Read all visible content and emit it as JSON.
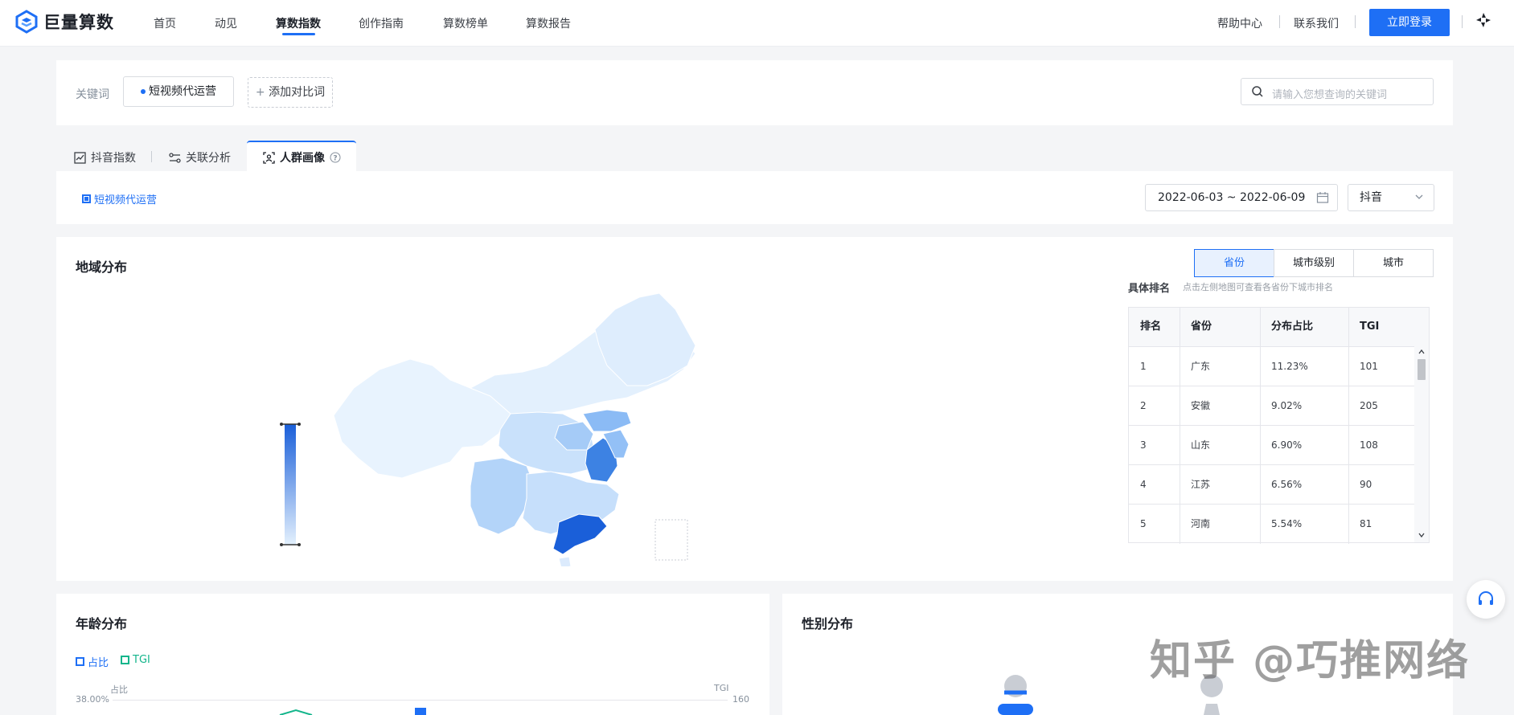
{
  "nav": {
    "logo": "巨量算数",
    "items": [
      "首页",
      "动见",
      "算数指数",
      "创作指南",
      "算数榜单",
      "算数报告"
    ],
    "right": [
      "帮助中心",
      "联系我们"
    ],
    "login": "立即登录"
  },
  "keywords": {
    "label": "关键词",
    "chip": "短视频代运营",
    "add": "添加对比词",
    "search_placeholder": "请输入您想查询的关键词"
  },
  "tabs": [
    "抖音指数",
    "关联分析",
    "人群画像"
  ],
  "filter": {
    "legend": "短视频代运营",
    "date_range": "2022-06-03 ~ 2022-06-09",
    "platform": "抖音"
  },
  "region": {
    "title": "地域分布",
    "segments": [
      "省份",
      "城市级别",
      "城市"
    ],
    "rank_title": "具体排名",
    "rank_subtitle": "点击左侧地图可查看各省份下城市排名",
    "headers": [
      "排名",
      "省份",
      "分布占比",
      "TGI"
    ],
    "rows": [
      {
        "rank": "1",
        "province": "广东",
        "share": "11.23%",
        "tgi": "101"
      },
      {
        "rank": "2",
        "province": "安徽",
        "share": "9.02%",
        "tgi": "205"
      },
      {
        "rank": "3",
        "province": "山东",
        "share": "6.90%",
        "tgi": "108"
      },
      {
        "rank": "4",
        "province": "江苏",
        "share": "6.56%",
        "tgi": "90"
      },
      {
        "rank": "5",
        "province": "河南",
        "share": "5.54%",
        "tgi": "81"
      }
    ]
  },
  "age": {
    "title": "年龄分布",
    "legend_share": "占比",
    "legend_tgi": "TGI",
    "y_left_label": "占比",
    "y_right_label": "TGI",
    "y_left_max": "38.00%",
    "y_right_max": "160"
  },
  "gender": {
    "title": "性别分布"
  },
  "watermark": "知乎 @巧推网络",
  "colors": {
    "accent": "#1e6ff5",
    "tgi": "#13b58b",
    "map_low": "#e3f0fd",
    "map_high": "#1a5fd9"
  }
}
